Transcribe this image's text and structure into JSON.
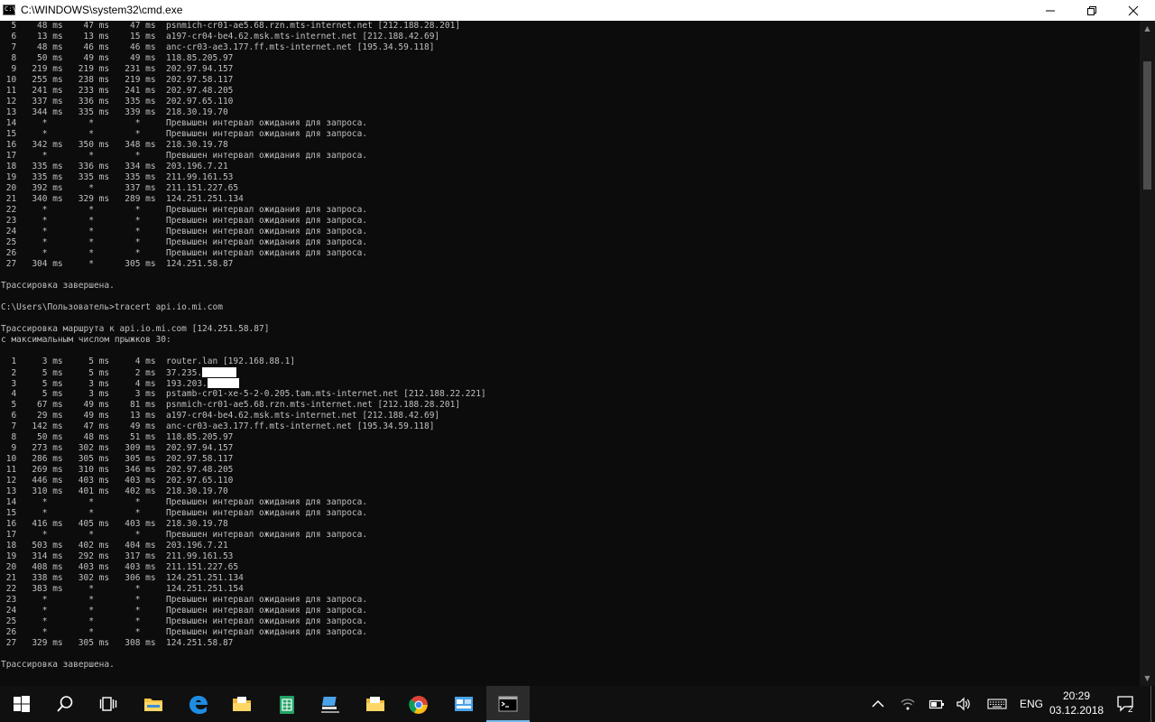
{
  "window": {
    "title": "C:\\WINDOWS\\system32\\cmd.exe",
    "icon": "cmd-icon",
    "controls": [
      "minimize-icon",
      "maximize-icon",
      "close-icon"
    ]
  },
  "console": {
    "text_color": "#c0c0c0",
    "background": "#0c0c0c",
    "lines": [
      "  5    48 ms    47 ms    47 ms  psnmich-cr01-ae5.68.rzn.mts-internet.net [212.188.28.201]",
      "  6    13 ms    13 ms    15 ms  a197-cr04-be4.62.msk.mts-internet.net [212.188.42.69]",
      "  7    48 ms    46 ms    46 ms  anc-cr03-ae3.177.ff.mts-internet.net [195.34.59.118]",
      "  8    50 ms    49 ms    49 ms  118.85.205.97",
      "  9   219 ms   219 ms   231 ms  202.97.94.157",
      " 10   255 ms   238 ms   219 ms  202.97.58.117",
      " 11   241 ms   233 ms   241 ms  202.97.48.205",
      " 12   337 ms   336 ms   335 ms  202.97.65.110",
      " 13   344 ms   335 ms   339 ms  218.30.19.70",
      " 14     *        *        *     Превышен интервал ожидания для запроса.",
      " 15     *        *        *     Превышен интервал ожидания для запроса.",
      " 16   342 ms   350 ms   348 ms  218.30.19.78",
      " 17     *        *        *     Превышен интервал ожидания для запроса.",
      " 18   335 ms   336 ms   334 ms  203.196.7.21",
      " 19   335 ms   335 ms   335 ms  211.99.161.53",
      " 20   392 ms     *      337 ms  211.151.227.65",
      " 21   340 ms   329 ms   289 ms  124.251.251.134",
      " 22     *        *        *     Превышен интервал ожидания для запроса.",
      " 23     *        *        *     Превышен интервал ожидания для запроса.",
      " 24     *        *        *     Превышен интервал ожидания для запроса.",
      " 25     *        *        *     Превышен интервал ожидания для запроса.",
      " 26     *        *        *     Превышен интервал ожидания для запроса.",
      " 27   304 ms     *      305 ms  124.251.58.87",
      "",
      "Трассировка завершена.",
      "",
      "C:\\Users\\Пользователь>tracert api.io.mi.com",
      "",
      "Трассировка маршрута к api.io.mi.com [124.251.58.87]",
      "с максимальным числом прыжков 30:",
      "",
      "  1     3 ms     5 ms     4 ms  router.lan [192.168.88.1]",
      "  2     5 ms     5 ms     2 ms  37.235.",
      "  3     5 ms     3 ms     4 ms  193.203.",
      "  4     5 ms     3 ms     3 ms  pstamb-cr01-xe-5-2-0.205.tam.mts-internet.net [212.188.22.221]",
      "  5    67 ms    49 ms    81 ms  psnmich-cr01-ae5.68.rzn.mts-internet.net [212.188.28.201]",
      "  6    29 ms    49 ms    13 ms  a197-cr04-be4.62.msk.mts-internet.net [212.188.42.69]",
      "  7   142 ms    47 ms    49 ms  anc-cr03-ae3.177.ff.mts-internet.net [195.34.59.118]",
      "  8    50 ms    48 ms    51 ms  118.85.205.97",
      "  9   273 ms   302 ms   309 ms  202.97.94.157",
      " 10   286 ms   305 ms   305 ms  202.97.58.117",
      " 11   269 ms   310 ms   346 ms  202.97.48.205",
      " 12   446 ms   403 ms   403 ms  202.97.65.110",
      " 13   310 ms   401 ms   402 ms  218.30.19.70",
      " 14     *        *        *     Превышен интервал ожидания для запроса.",
      " 15     *        *        *     Превышен интервал ожидания для запроса.",
      " 16   416 ms   405 ms   403 ms  218.30.19.78",
      " 17     *        *        *     Превышен интервал ожидания для запроса.",
      " 18   503 ms   402 ms   404 ms  203.196.7.21",
      " 19   314 ms   292 ms   317 ms  211.99.161.53",
      " 20   408 ms   403 ms   403 ms  211.151.227.65",
      " 21   338 ms   302 ms   306 ms  124.251.251.134",
      " 22   383 ms     *        *     124.251.251.154",
      " 23     *        *        *     Превышен интервал ожидания для запроса.",
      " 24     *        *        *     Превышен интервал ожидания для запроса.",
      " 25     *        *        *     Превышен интервал ожидания для запроса.",
      " 26     *        *        *     Превышен интервал ожидания для запроса.",
      " 27   329 ms   305 ms   308 ms  124.251.58.87",
      "",
      "Трассировка завершена."
    ],
    "redacted_line_indices": [
      32,
      33
    ]
  },
  "taskbar": {
    "pinned": [
      {
        "name": "start-button",
        "icon": "windows-logo-icon"
      },
      {
        "name": "search-button",
        "icon": "search-icon"
      },
      {
        "name": "task-view-button",
        "icon": "task-view-icon"
      },
      {
        "name": "file-explorer-button",
        "icon": "folder-icon"
      },
      {
        "name": "edge-button",
        "icon": "edge-icon"
      },
      {
        "name": "file-manager-button",
        "icon": "folder-docs-icon"
      },
      {
        "name": "sheets-button",
        "icon": "spreadsheet-icon"
      },
      {
        "name": "network-app-button",
        "icon": "network-pc-icon"
      },
      {
        "name": "documents-button",
        "icon": "folder-docs-icon"
      },
      {
        "name": "chrome-button",
        "icon": "chrome-icon"
      },
      {
        "name": "control-panel-button",
        "icon": "control-panel-icon"
      },
      {
        "name": "cmd-button",
        "icon": "cmd-icon",
        "active": true
      }
    ],
    "tray": {
      "language": "ENG",
      "time": "20:29",
      "date": "03.12.2018",
      "notification_count": "2"
    }
  }
}
